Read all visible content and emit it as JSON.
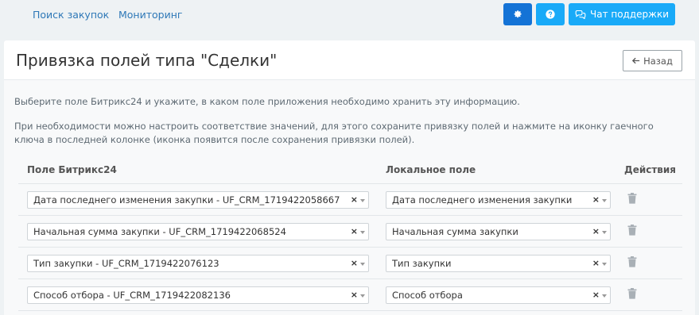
{
  "topnav": {
    "links": [
      "Поиск закупок",
      "Мониторинг"
    ],
    "chat_label": "Чат поддержки"
  },
  "page": {
    "title": "Привязка полей типа \"Сделки\"",
    "back_label": "Назад"
  },
  "info": {
    "p1": "Выберите поле Битрикс24 и укажите, в каком поле приложения необходимо хранить эту информацию.",
    "p2": "При необходимости можно настроить соответствие значений, для этого сохраните привязку полей и нажмите на иконку гаечного ключа в последней колонке (иконка появится после сохранения привязки полей)."
  },
  "table": {
    "headers": [
      "Поле Битрикс24",
      "Локальное поле",
      "Действия"
    ],
    "rows": [
      {
        "remote": "Дата последнего изменения закупки - UF_CRM_1719422058667",
        "local": "Дата последнего изменения закупки"
      },
      {
        "remote": "Начальная сумма закупки - UF_CRM_1719422068524",
        "local": "Начальная сумма закупки"
      },
      {
        "remote": "Тип закупки - UF_CRM_1719422076123",
        "local": "Тип закупки"
      },
      {
        "remote": "Способ отбора - UF_CRM_1719422082136",
        "local": "Способ отбора"
      }
    ]
  },
  "icons": {
    "settings": "gear-icon",
    "help": "question-icon",
    "chat": "chat-bubbles-icon",
    "back": "arrow-left-icon",
    "remove": "trash-icon"
  },
  "colors": {
    "link": "#2e78b7",
    "primary": "#1473d6",
    "accent": "#19aaf8",
    "background": "#eef2f4"
  }
}
